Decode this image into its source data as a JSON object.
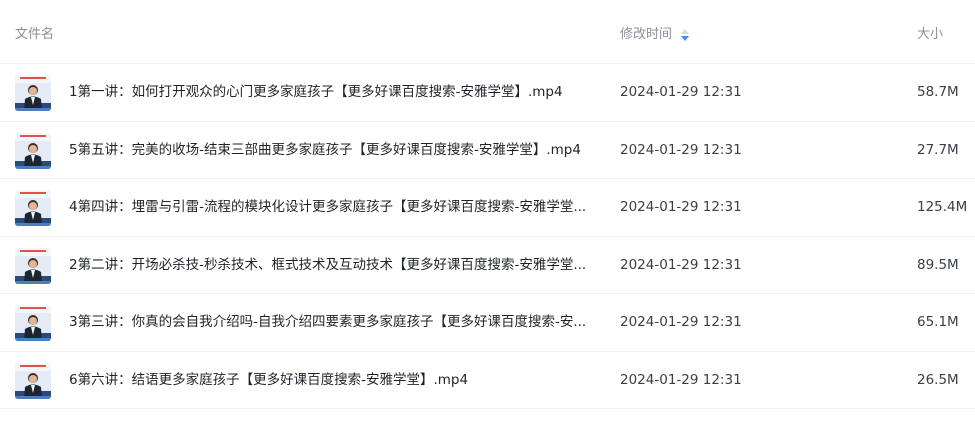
{
  "header": {
    "name_label": "文件名",
    "time_label": "修改时间",
    "size_label": "大小",
    "sort_icon": "sort-icon"
  },
  "colors": {
    "sort_up": "#d6dbe3",
    "sort_down": "#3b8cff"
  },
  "files": [
    {
      "name": "1第一讲：如何打开观众的心门更多家庭孩子【更多好课百度搜索-安雅学堂】.mp4",
      "modified": "2024-01-29 12:31",
      "size": "58.7M",
      "icon": "video-thumbnail-icon"
    },
    {
      "name": "5第五讲：完美的收场-结束三部曲更多家庭孩子【更多好课百度搜索-安雅学堂】.mp4",
      "modified": "2024-01-29 12:31",
      "size": "27.7M",
      "icon": "video-thumbnail-icon"
    },
    {
      "name": "4第四讲：埋雷与引雷-流程的模块化设计更多家庭孩子【更多好课百度搜索-安雅学堂...",
      "modified": "2024-01-29 12:31",
      "size": "125.4M",
      "icon": "video-thumbnail-icon"
    },
    {
      "name": "2第二讲：开场必杀技-秒杀技术、框式技术及互动技术【更多好课百度搜索-安雅学堂...",
      "modified": "2024-01-29 12:31",
      "size": "89.5M",
      "icon": "video-thumbnail-icon"
    },
    {
      "name": "3第三讲：你真的会自我介绍吗-自我介绍四要素更多家庭孩子【更多好课百度搜索-安...",
      "modified": "2024-01-29 12:31",
      "size": "65.1M",
      "icon": "video-thumbnail-icon"
    },
    {
      "name": "6第六讲：结语更多家庭孩子【更多好课百度搜索-安雅学堂】.mp4",
      "modified": "2024-01-29 12:31",
      "size": "26.5M",
      "icon": "video-thumbnail-icon"
    }
  ]
}
